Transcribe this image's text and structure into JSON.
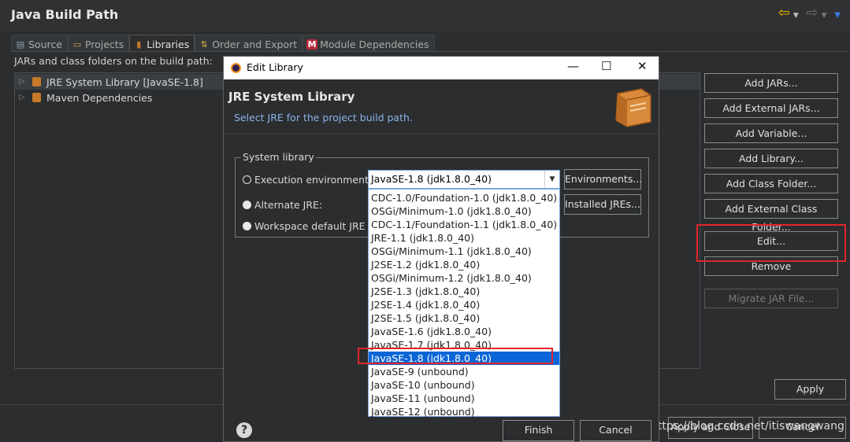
{
  "window": {
    "title": "Java Build Path"
  },
  "tabs": [
    {
      "label": "Source",
      "icon": "source-icon"
    },
    {
      "label": "Projects",
      "icon": "folder-icon"
    },
    {
      "label": "Libraries",
      "icon": "library-icon"
    },
    {
      "label": "Order and Export",
      "icon": "order-icon"
    },
    {
      "label": "Module Dependencies",
      "icon": "module-icon"
    }
  ],
  "libraries_label": "JARs and class folders on the build path:",
  "tree": [
    {
      "label": "JRE System Library [JavaSE-1.8]"
    },
    {
      "label": "Maven Dependencies"
    }
  ],
  "right_buttons": {
    "add_jars": "Add JARs...",
    "add_external_jars": "Add External JARs...",
    "add_variable": "Add Variable...",
    "add_library": "Add Library...",
    "add_class_folder": "Add Class Folder...",
    "add_external_class_folder": "Add External Class Folder...",
    "edit": "Edit...",
    "remove": "Remove",
    "migrate": "Migrate JAR File..."
  },
  "apply": "Apply",
  "apply_and_close": "Apply and Close",
  "cancel_outer": "Cancel",
  "watermark": "https://blog.csdn.net/itiswangwang",
  "modal": {
    "title": "Edit Library",
    "heading": "JRE System Library",
    "subheading": "Select JRE for the project build path.",
    "group_label": "System library",
    "radio_exec": "Execution environment:",
    "radio_alt": "Alternate JRE:",
    "radio_workspace": "Workspace default JRE (j",
    "combo_value": "JavaSE-1.8 (jdk1.8.0_40)",
    "environments_button": "Environments...",
    "installed_jres_button": "Installed JREs...",
    "options": [
      "CDC-1.0/Foundation-1.0 (jdk1.8.0_40)",
      "OSGi/Minimum-1.0 (jdk1.8.0_40)",
      "CDC-1.1/Foundation-1.1 (jdk1.8.0_40)",
      "JRE-1.1 (jdk1.8.0_40)",
      "OSGi/Minimum-1.1 (jdk1.8.0_40)",
      "J2SE-1.2 (jdk1.8.0_40)",
      "OSGi/Minimum-1.2 (jdk1.8.0_40)",
      "J2SE-1.3 (jdk1.8.0_40)",
      "J2SE-1.4 (jdk1.8.0_40)",
      "J2SE-1.5 (jdk1.8.0_40)",
      "JavaSE-1.6 (jdk1.8.0_40)",
      "JavaSE-1.7 (jdk1.8.0_40)",
      "JavaSE-1.8 (jdk1.8.0_40)",
      "JavaSE-9 (unbound)",
      "JavaSE-10 (unbound)",
      "JavaSE-11 (unbound)",
      "JavaSE-12 (unbound)"
    ],
    "selected_option": "JavaSE-1.8 (jdk1.8.0_40)",
    "finish": "Finish",
    "cancel": "Cancel"
  },
  "colors": {
    "accent": "#0a66d6",
    "highlight_box": "#e0262b",
    "library_icon": "#c67a2a"
  }
}
